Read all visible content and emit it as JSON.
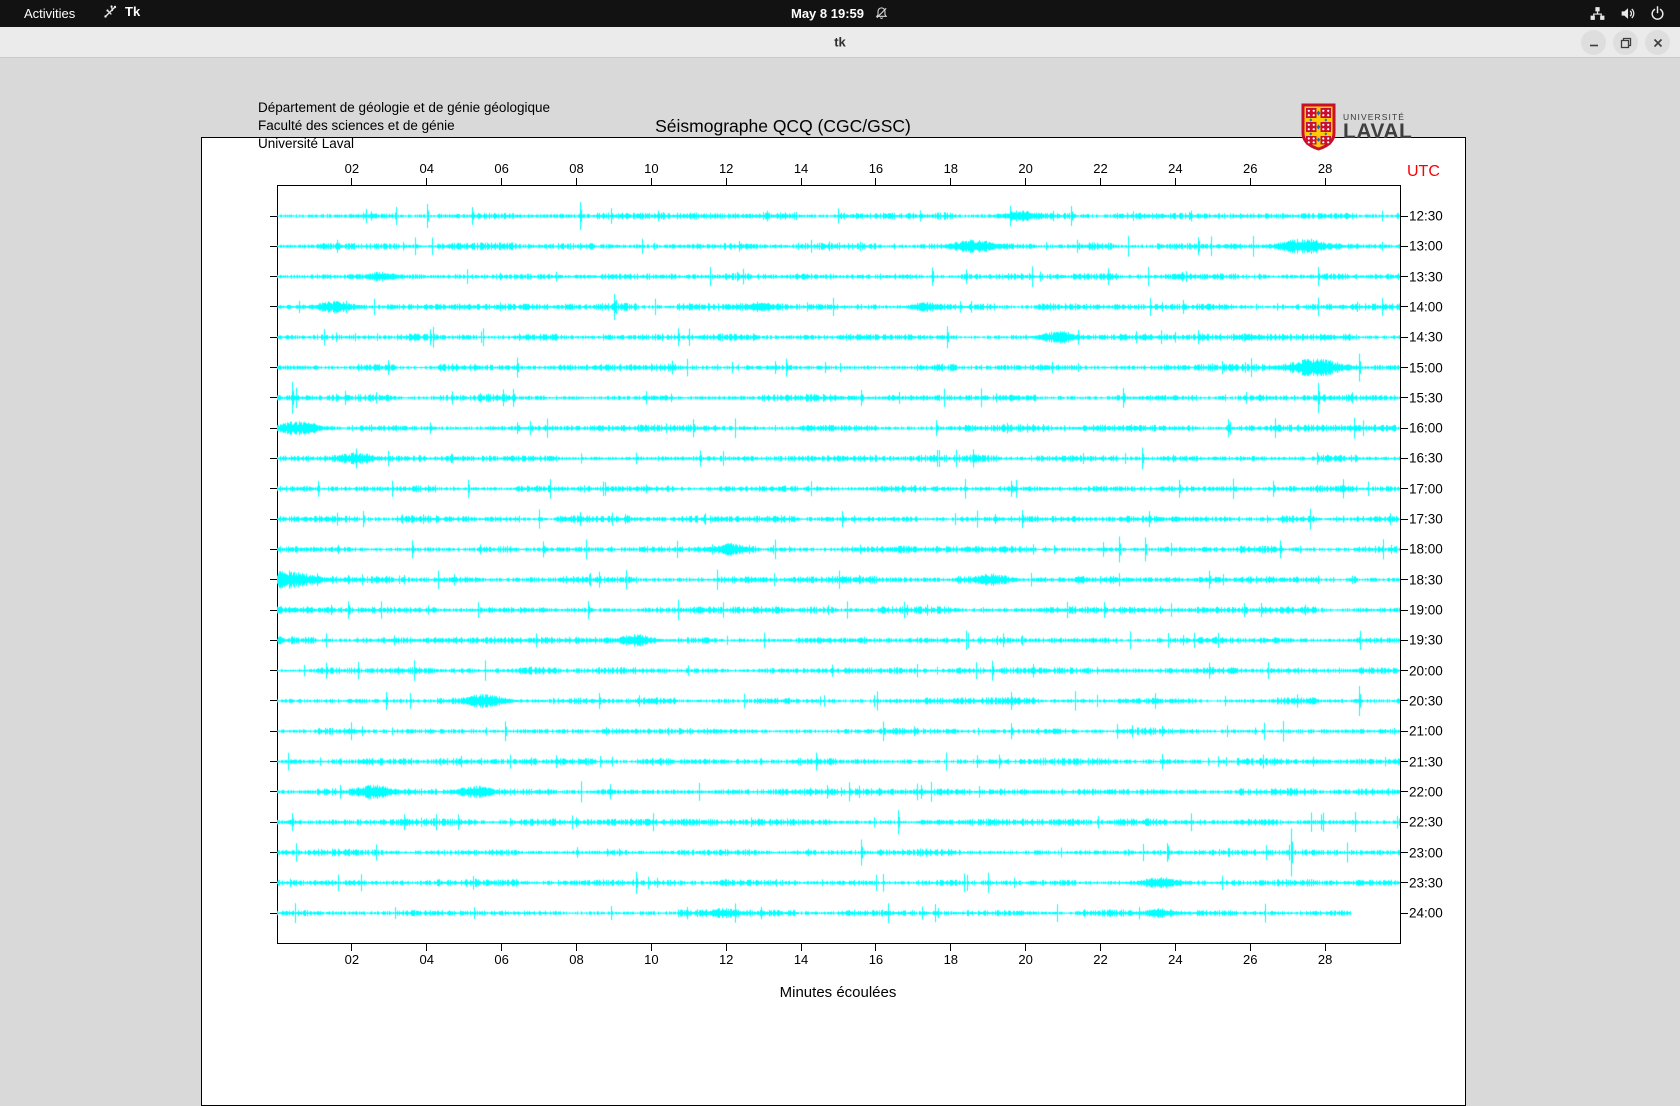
{
  "top_bar": {
    "activities_label": "Activities",
    "app_name": "Tk",
    "clock": "May 8 19:59",
    "icons": [
      "tk-icon",
      "notifications-muted-icon",
      "network-wired-icon",
      "volume-icon",
      "power-icon"
    ]
  },
  "window": {
    "title": "tk",
    "controls": [
      "minimize",
      "maximize",
      "close"
    ]
  },
  "chart": {
    "header_lines": [
      "Département de géologie et de génie géologique",
      "Faculté des sciences et de génie",
      "Université Laval"
    ],
    "title": "Séismographe QCQ (CGC/GSC)",
    "utc_label": "UTC",
    "x_axis_title": "Minutes écoulées",
    "logo": {
      "line1": "UNIVERSITÉ",
      "line2": "LAVAL",
      "shield_red": "#c8102e",
      "shield_yellow": "#ffcb05",
      "shield_blue": "#1f6bb5"
    },
    "trace_color": "#00ffff",
    "utc_color": "#fb0006"
  },
  "chart_data": {
    "type": "line",
    "title": "Séismographe QCQ (CGC/GSC)",
    "xlabel": "Minutes écoulées",
    "x_range_minutes": [
      0,
      30
    ],
    "x_tick_labels": [
      "02",
      "04",
      "06",
      "08",
      "10",
      "12",
      "14",
      "16",
      "18",
      "20",
      "22",
      "24",
      "26",
      "28"
    ],
    "row_labels_utc": [
      "12:30",
      "13:00",
      "13:30",
      "14:00",
      "14:30",
      "15:00",
      "15:30",
      "16:00",
      "16:30",
      "17:00",
      "17:30",
      "18:00",
      "18:30",
      "19:00",
      "19:30",
      "20:00",
      "20:30",
      "21:00",
      "21:30",
      "22:00",
      "22:30",
      "23:00",
      "23:30",
      "24:00"
    ],
    "last_row_end_minute": 28.7,
    "noise_seed": 987654,
    "events": [
      [
        0,
        4.0,
        "s",
        12
      ],
      [
        0,
        5.2,
        "s",
        9
      ],
      [
        0,
        8.1,
        "s",
        14
      ],
      [
        0,
        19.9,
        "b",
        6
      ],
      [
        0,
        21.2,
        "s",
        10
      ],
      [
        1,
        18.6,
        "b",
        7
      ],
      [
        1,
        24.6,
        "s",
        9
      ],
      [
        1,
        27.4,
        "b",
        8
      ],
      [
        2,
        2.8,
        "b",
        5
      ],
      [
        2,
        17.5,
        "s",
        9
      ],
      [
        2,
        18.4,
        "s",
        7
      ],
      [
        3,
        1.5,
        "b",
        6
      ],
      [
        3,
        9.0,
        "s",
        13
      ],
      [
        3,
        12.9,
        "b",
        5
      ],
      [
        3,
        17.3,
        "b",
        5
      ],
      [
        3,
        24.2,
        "s",
        7
      ],
      [
        4,
        4.1,
        "s",
        8
      ],
      [
        4,
        10.7,
        "s",
        9
      ],
      [
        4,
        17.9,
        "s",
        11
      ],
      [
        4,
        20.9,
        "b",
        6
      ],
      [
        4,
        24.6,
        "s",
        7
      ],
      [
        5,
        6.4,
        "s",
        10
      ],
      [
        5,
        13.6,
        "s",
        9
      ],
      [
        5,
        27.7,
        "b",
        9
      ],
      [
        5,
        28.9,
        "s",
        14
      ],
      [
        6,
        0.4,
        "s",
        16
      ],
      [
        6,
        6.3,
        "s",
        9
      ],
      [
        6,
        15.6,
        "s",
        8
      ],
      [
        6,
        22.6,
        "s",
        10
      ],
      [
        6,
        27.8,
        "s",
        15
      ],
      [
        7,
        0.6,
        "b",
        7
      ],
      [
        7,
        11.1,
        "s",
        9
      ],
      [
        7,
        17.6,
        "s",
        8
      ],
      [
        7,
        25.4,
        "s",
        9
      ],
      [
        8,
        2.1,
        "b",
        6
      ],
      [
        8,
        11.3,
        "s",
        8
      ],
      [
        8,
        18.6,
        "s",
        9
      ],
      [
        8,
        23.1,
        "s",
        11
      ],
      [
        9,
        1.1,
        "s",
        8
      ],
      [
        9,
        5.1,
        "s",
        9
      ],
      [
        9,
        19.6,
        "s",
        8
      ],
      [
        9,
        24.1,
        "s",
        9
      ],
      [
        9,
        26.6,
        "s",
        8
      ],
      [
        10,
        2.3,
        "s",
        8
      ],
      [
        10,
        8.1,
        "s",
        7
      ],
      [
        10,
        15.1,
        "s",
        8
      ],
      [
        10,
        19.9,
        "s",
        9
      ],
      [
        10,
        23.3,
        "s",
        8
      ],
      [
        11,
        3.6,
        "s",
        9
      ],
      [
        11,
        7.1,
        "s",
        8
      ],
      [
        11,
        12.1,
        "b",
        6
      ],
      [
        11,
        22.5,
        "s",
        13
      ],
      [
        11,
        23.2,
        "s",
        12
      ],
      [
        11,
        26.8,
        "s",
        9
      ],
      [
        12,
        0.3,
        "b",
        9
      ],
      [
        12,
        8.6,
        "s",
        8
      ],
      [
        12,
        19.1,
        "b",
        6
      ],
      [
        12,
        24.9,
        "s",
        9
      ],
      [
        13,
        8.3,
        "s",
        9
      ],
      [
        13,
        22.1,
        "s",
        8
      ],
      [
        13,
        26.3,
        "s",
        7
      ],
      [
        14,
        9.6,
        "b",
        6
      ],
      [
        14,
        19.4,
        "s",
        7
      ],
      [
        15,
        1.3,
        "s",
        8
      ],
      [
        15,
        19.1,
        "s",
        10
      ],
      [
        15,
        24.9,
        "s",
        8
      ],
      [
        16,
        2.9,
        "s",
        9
      ],
      [
        16,
        5.5,
        "b",
        7
      ],
      [
        16,
        8.6,
        "s",
        8
      ],
      [
        16,
        19.6,
        "s",
        9
      ],
      [
        16,
        28.9,
        "s",
        15
      ],
      [
        17,
        6.1,
        "s",
        10
      ],
      [
        17,
        19.6,
        "s",
        8
      ],
      [
        18,
        14.4,
        "s",
        9
      ],
      [
        18,
        19.3,
        "s",
        7
      ],
      [
        19,
        2.6,
        "b",
        7
      ],
      [
        19,
        5.3,
        "b",
        6
      ],
      [
        20,
        0.4,
        "s",
        9
      ],
      [
        20,
        3.4,
        "s",
        8
      ],
      [
        20,
        16.6,
        "s",
        12
      ],
      [
        21,
        15.6,
        "s",
        13
      ],
      [
        21,
        27.1,
        "s",
        24
      ],
      [
        22,
        9.6,
        "s",
        11
      ],
      [
        22,
        23.6,
        "b",
        6
      ],
      [
        23,
        11.9,
        "b",
        5
      ],
      [
        23,
        23.6,
        "b",
        5
      ]
    ]
  }
}
